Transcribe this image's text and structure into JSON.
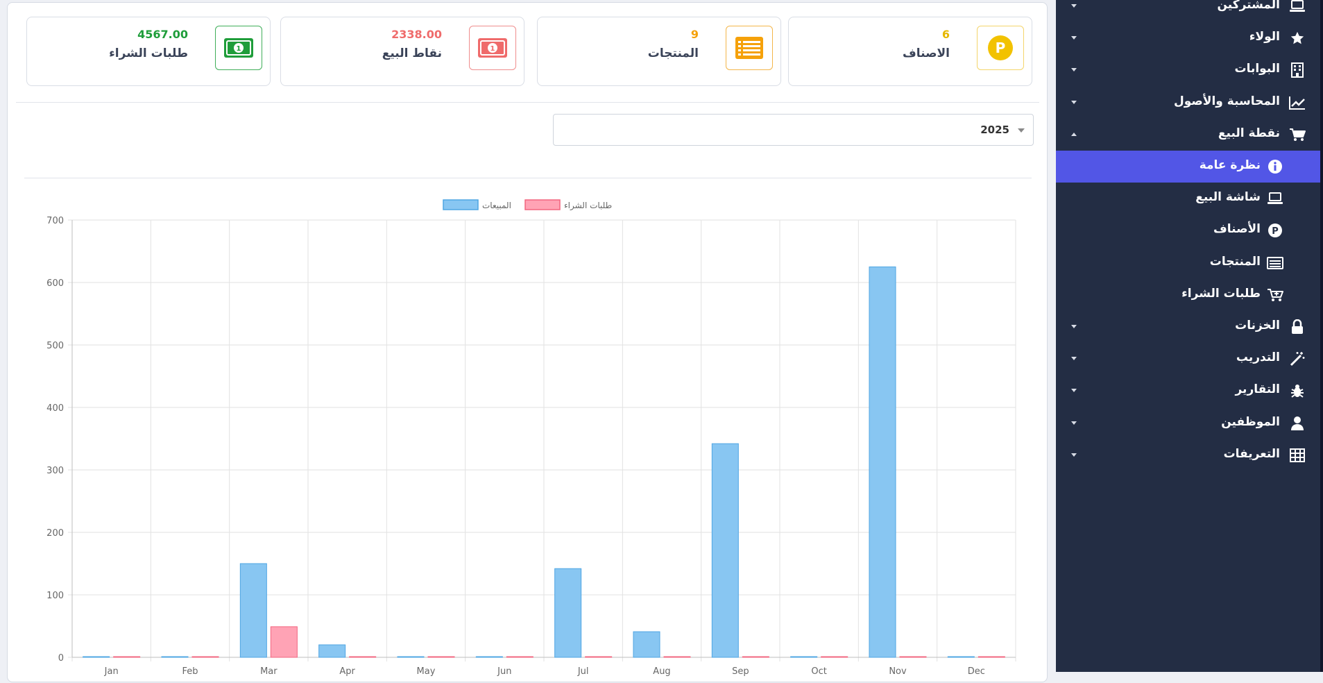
{
  "cards": [
    {
      "value": "6",
      "label": "الاصناف",
      "icon": "parking-circle-icon",
      "color": "#f2c200",
      "border": "#f4d56a"
    },
    {
      "value": "9",
      "label": "المنتجات",
      "icon": "list-icon",
      "color": "#f5a10a",
      "border": "#f3b64a"
    },
    {
      "value": "2338.00",
      "label": "نقاط البيع",
      "icon": "money-bill-icon",
      "color": "#ef6b6b",
      "border": "#ef8d8d"
    },
    {
      "value": "4567.00",
      "label": "طلبات الشراء",
      "icon": "money-bill-icon",
      "color": "#1f9d3a",
      "border": "#3fae59"
    }
  ],
  "year_select": {
    "value": "2025"
  },
  "chart_data": {
    "type": "bar",
    "categories": [
      "Jan",
      "Feb",
      "Mar",
      "Apr",
      "May",
      "Jun",
      "Jul",
      "Aug",
      "Sep",
      "Oct",
      "Nov",
      "Dec"
    ],
    "series": [
      {
        "name": "المبيعات",
        "values": [
          0,
          0,
          150,
          20,
          0,
          0,
          142,
          41,
          342,
          0,
          625,
          0
        ],
        "color": "#88c6f2",
        "stroke": "#4fa6e3"
      },
      {
        "name": "طلبات الشراء",
        "values": [
          0,
          0,
          49,
          0,
          0,
          0,
          0,
          1,
          0,
          0,
          0,
          0
        ],
        "color": "#ffa3b5",
        "stroke": "#f2657f"
      }
    ],
    "ylim": [
      0,
      700
    ],
    "yticks": [
      0,
      100,
      200,
      300,
      400,
      500,
      600,
      700
    ],
    "grid": true,
    "legend": "top"
  },
  "sidebar": {
    "items": [
      {
        "label": "المشتركين",
        "icon": "laptop-icon",
        "arrow": "down"
      },
      {
        "label": "الولاء",
        "icon": "star-icon",
        "arrow": "down"
      },
      {
        "label": "البوابات",
        "icon": "building-icon",
        "arrow": "down"
      },
      {
        "label": "المحاسبة والأصول",
        "icon": "chart-line-icon",
        "arrow": "down"
      },
      {
        "label": "نقطة البيع",
        "icon": "cart-icon",
        "arrow": "up"
      }
    ],
    "sub_items": [
      {
        "label": "نظرة عامة",
        "icon": "info-circle-icon",
        "active": true
      },
      {
        "label": "شاشة البيع",
        "icon": "laptop-icon"
      },
      {
        "label": "الأصناف",
        "icon": "parking-circle-icon"
      },
      {
        "label": "المنتجات",
        "icon": "list-icon"
      },
      {
        "label": "طلبات الشراء",
        "icon": "cart-plus-icon"
      }
    ],
    "items_after": [
      {
        "label": "الخزنات",
        "icon": "lock-icon",
        "arrow": "down"
      },
      {
        "label": "التدريب",
        "icon": "magic-wand-icon",
        "arrow": "down"
      },
      {
        "label": "التقارير",
        "icon": "bug-icon",
        "arrow": "down"
      },
      {
        "label": "الموظفين",
        "icon": "user-icon",
        "arrow": "down"
      },
      {
        "label": "التعريفات",
        "icon": "table-icon",
        "arrow": "down"
      }
    ]
  }
}
